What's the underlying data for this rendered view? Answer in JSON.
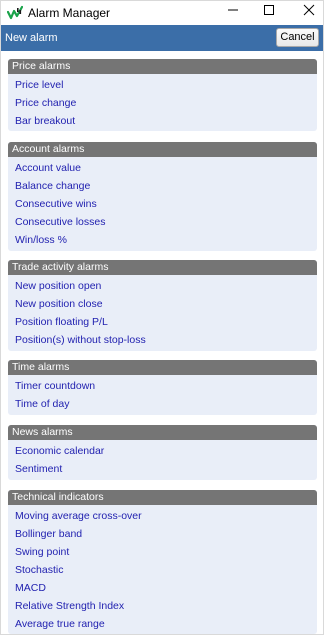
{
  "window": {
    "title": "Alarm Manager",
    "app_icon": "chart-icon",
    "buttons": {
      "minimize": "minimize-icon",
      "maximize": "maximize-icon",
      "close": "close-icon"
    }
  },
  "header": {
    "title": "New alarm",
    "cancel_label": "Cancel"
  },
  "colors": {
    "header_bg": "#3b6ea8",
    "group_header_bg": "#757575",
    "group_bg": "#e9eef8",
    "link_color": "#2222b0"
  },
  "groups": [
    {
      "title": "Price alarms",
      "items": [
        "Price level",
        "Price change",
        "Bar breakout"
      ]
    },
    {
      "title": "Account alarms",
      "items": [
        "Account value",
        "Balance change",
        "Consecutive wins",
        "Consecutive losses",
        "Win/loss %"
      ]
    },
    {
      "title": "Trade activity alarms",
      "items": [
        "New position open",
        "New position close",
        "Position floating P/L",
        "Position(s) without stop-loss"
      ]
    },
    {
      "title": "Time alarms",
      "items": [
        "Timer countdown",
        "Time of day"
      ]
    },
    {
      "title": "News alarms",
      "items": [
        "Economic calendar",
        "Sentiment"
      ]
    },
    {
      "title": "Technical indicators",
      "items": [
        "Moving average cross-over",
        "Bollinger band",
        "Swing point",
        "Stochastic",
        "MACD",
        "Relative Strength Index",
        "Average true range"
      ]
    }
  ]
}
